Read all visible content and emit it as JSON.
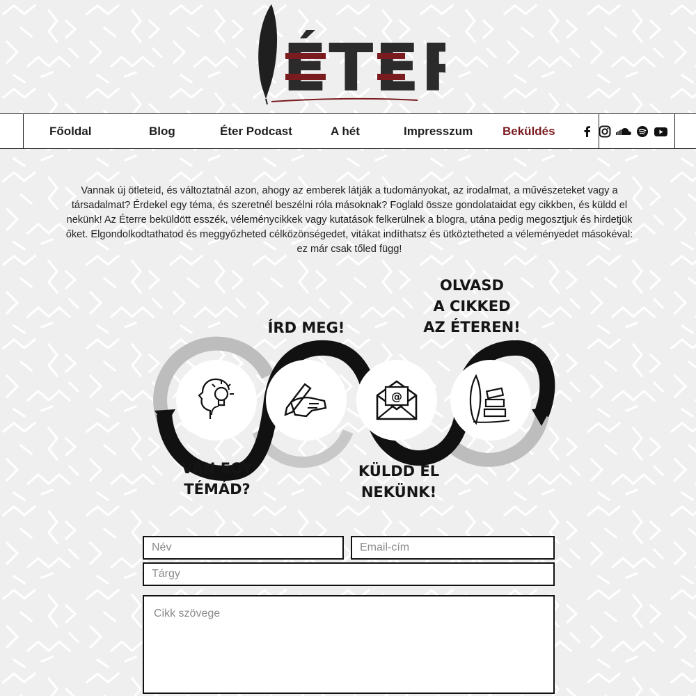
{
  "brand": {
    "logo_text": "ÉTER",
    "accent": "#7a1b1f"
  },
  "nav": {
    "items": [
      {
        "label": "Főoldal",
        "active": false
      },
      {
        "label": "Blog",
        "active": false
      },
      {
        "label": "Éter Podcast",
        "active": false
      },
      {
        "label": "A hét",
        "active": false
      },
      {
        "label": "Impresszum",
        "active": false
      },
      {
        "label": "Beküldés",
        "active": true
      }
    ],
    "social": [
      "facebook-icon",
      "instagram-icon",
      "soundcloud-icon",
      "spotify-icon",
      "youtube-icon"
    ]
  },
  "intro": {
    "text": "Vannak új ötleteid, és változtatnál azon, ahogy az emberek látják a tudományokat, az irodalmat, a művészeteket vagy a társadalmat? Érdekel egy téma, és szeretnél beszélni róla másoknak? Foglald össze gondolataidat egy cikkben, és küldd el nekünk! Az Éterre beküldött esszék, véleménycikkek vagy kutatások felkerülnek a blogra, utána pedig megosztjuk és hirdetjük őket. Elgondolkodtathatod és meggyőzheted célközönségedet, vitákat indíthatsz és ütköztetheted a véleményedet másokéval: ez már csak tőled függ!"
  },
  "process": {
    "steps": [
      {
        "label": "VAN EGY\nTÉMÁD?",
        "icon": "head-lightbulb-icon"
      },
      {
        "label": "ÍRD MEG!",
        "icon": "hand-writing-icon"
      },
      {
        "label": "KÜLDD EL\nNEKÜNK!",
        "icon": "envelope-email-icon"
      },
      {
        "label": "OLVASD\nA CIKKED\nAZ ÉTEREN!",
        "icon": "quill-books-icon"
      }
    ]
  },
  "form": {
    "name_placeholder": "Név",
    "email_placeholder": "Email-cím",
    "subject_placeholder": "Tárgy",
    "body_placeholder": "Cikk szövege"
  }
}
